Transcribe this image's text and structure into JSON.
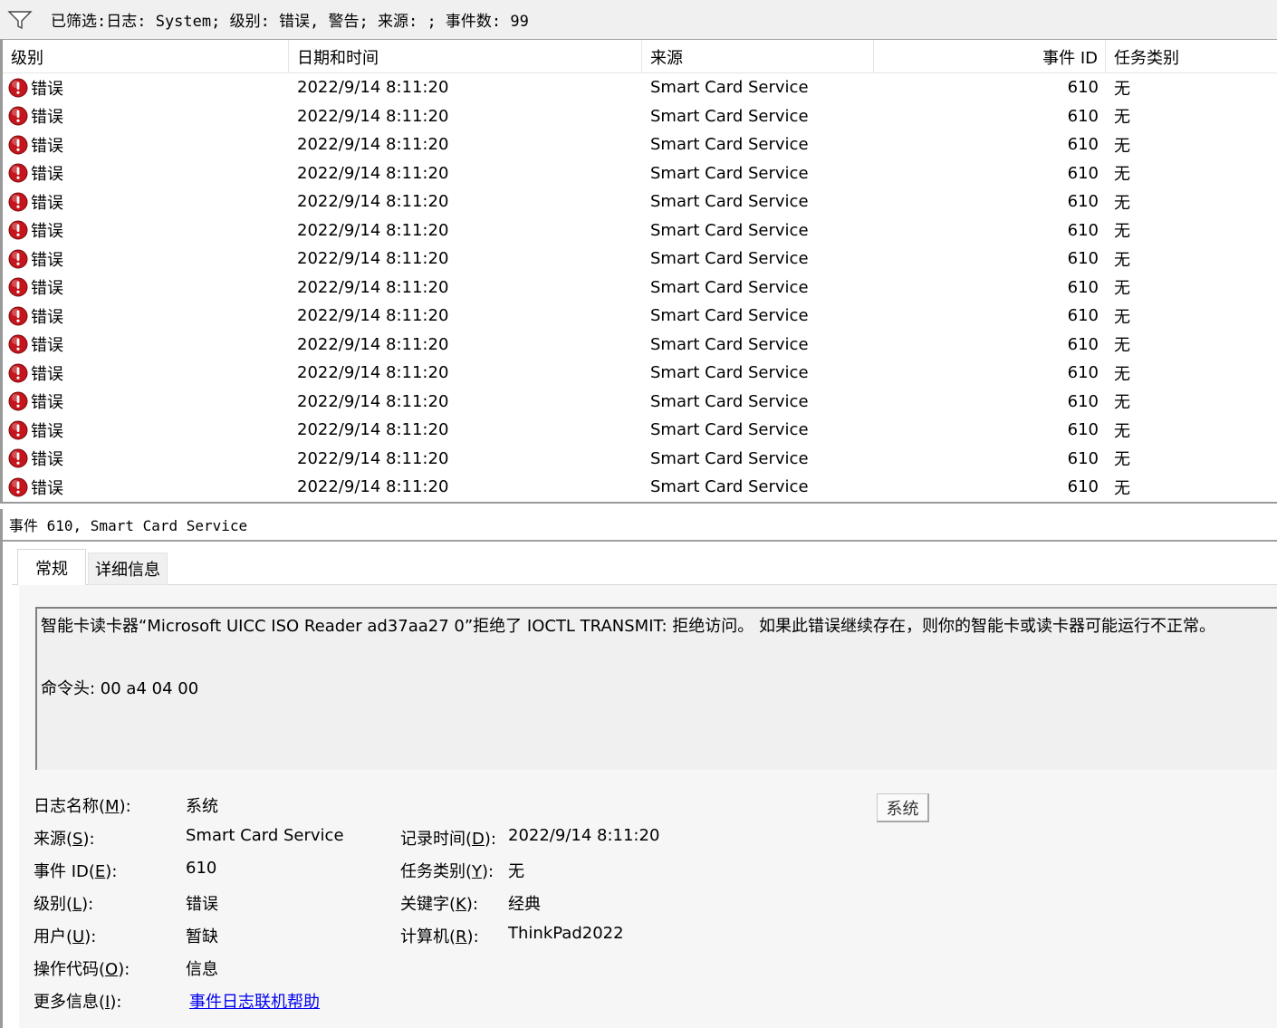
{
  "filter": {
    "icon": "funnel-icon",
    "text": "已筛选:日志: System; 级别: 错误, 警告; 来源: ; 事件数: 99"
  },
  "columns": {
    "level": "级别",
    "date": "日期和时间",
    "source": "来源",
    "event_id": "事件 ID",
    "task": "任务类别"
  },
  "rows": [
    {
      "level": "错误",
      "date": "2022/9/14 8:11:20",
      "source": "Smart Card Service",
      "event_id": "610",
      "task": "无"
    },
    {
      "level": "错误",
      "date": "2022/9/14 8:11:20",
      "source": "Smart Card Service",
      "event_id": "610",
      "task": "无"
    },
    {
      "level": "错误",
      "date": "2022/9/14 8:11:20",
      "source": "Smart Card Service",
      "event_id": "610",
      "task": "无"
    },
    {
      "level": "错误",
      "date": "2022/9/14 8:11:20",
      "source": "Smart Card Service",
      "event_id": "610",
      "task": "无"
    },
    {
      "level": "错误",
      "date": "2022/9/14 8:11:20",
      "source": "Smart Card Service",
      "event_id": "610",
      "task": "无"
    },
    {
      "level": "错误",
      "date": "2022/9/14 8:11:20",
      "source": "Smart Card Service",
      "event_id": "610",
      "task": "无"
    },
    {
      "level": "错误",
      "date": "2022/9/14 8:11:20",
      "source": "Smart Card Service",
      "event_id": "610",
      "task": "无"
    },
    {
      "level": "错误",
      "date": "2022/9/14 8:11:20",
      "source": "Smart Card Service",
      "event_id": "610",
      "task": "无"
    },
    {
      "level": "错误",
      "date": "2022/9/14 8:11:20",
      "source": "Smart Card Service",
      "event_id": "610",
      "task": "无"
    },
    {
      "level": "错误",
      "date": "2022/9/14 8:11:20",
      "source": "Smart Card Service",
      "event_id": "610",
      "task": "无"
    },
    {
      "level": "错误",
      "date": "2022/9/14 8:11:20",
      "source": "Smart Card Service",
      "event_id": "610",
      "task": "无"
    },
    {
      "level": "错误",
      "date": "2022/9/14 8:11:20",
      "source": "Smart Card Service",
      "event_id": "610",
      "task": "无"
    },
    {
      "level": "错误",
      "date": "2022/9/14 8:11:20",
      "source": "Smart Card Service",
      "event_id": "610",
      "task": "无"
    },
    {
      "level": "错误",
      "date": "2022/9/14 8:11:20",
      "source": "Smart Card Service",
      "event_id": "610",
      "task": "无"
    },
    {
      "level": "错误",
      "date": "2022/9/14 8:11:20",
      "source": "Smart Card Service",
      "event_id": "610",
      "task": "无"
    }
  ],
  "detail": {
    "title": "事件 610, Smart Card Service",
    "tabs": {
      "general": "常规",
      "details": "详细信息"
    },
    "description_line1": "智能卡读卡器“Microsoft UICC ISO Reader ad37aa27 0”拒绝了 IOCTL TRANSMIT: 拒绝访问。 如果此错误继续存在，则你的智能卡或读卡器可能运行不正常。",
    "description_line2": "命令头: 00 a4 04 00",
    "labels": {
      "log_name_pre": "日志名称(",
      "log_name_key": "M",
      "log_name_post": "):",
      "source_pre": "来源(",
      "source_key": "S",
      "source_post": "):",
      "event_id_pre": "事件 ID(",
      "event_id_key": "E",
      "event_id_post": "):",
      "level_pre": "级别(",
      "level_key": "L",
      "level_post": "):",
      "user_pre": "用户(",
      "user_key": "U",
      "user_post": "):",
      "opcode_pre": "操作代码(",
      "opcode_key": "O",
      "opcode_post": "):",
      "more_pre": "更多信息(",
      "more_key": "I",
      "more_post": "):",
      "logged_pre": "记录时间(",
      "logged_key": "D",
      "logged_post": "):",
      "task_pre": "任务类别(",
      "task_key": "Y",
      "task_post": "):",
      "keywords_pre": "关键字(",
      "keywords_key": "K",
      "keywords_post": "):",
      "computer_pre": "计算机(",
      "computer_key": "R",
      "computer_post": "):"
    },
    "values": {
      "log_name": "系统",
      "source": "Smart Card Service",
      "event_id": "610",
      "level": "错误",
      "user": "暂缺",
      "opcode": "信息",
      "more_link": "事件日志联机帮助",
      "logged": "2022/9/14 8:11:20",
      "task": "无",
      "keywords": "经典",
      "computer": "ThinkPad2022"
    },
    "system_button": "系统"
  }
}
